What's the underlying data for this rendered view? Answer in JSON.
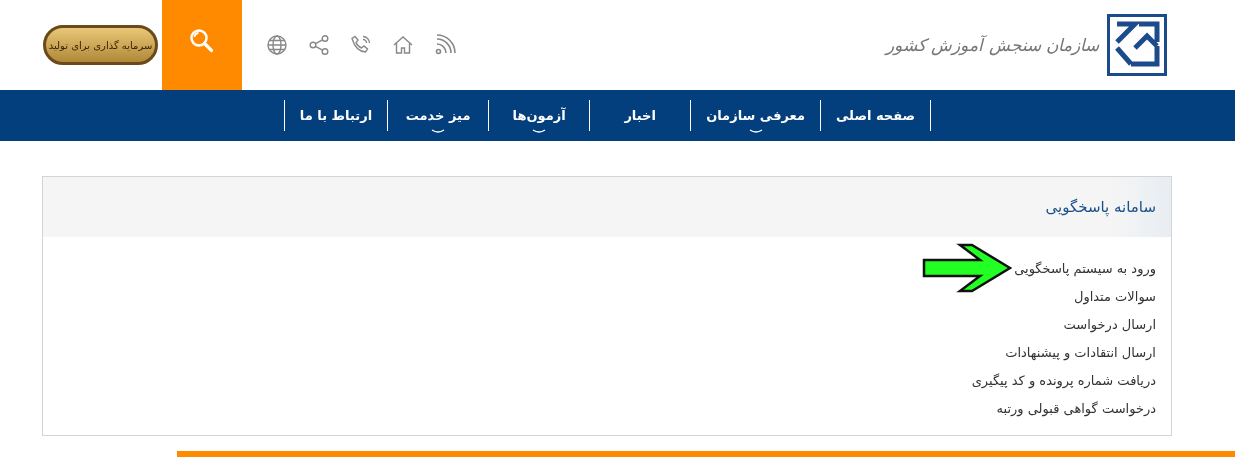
{
  "header": {
    "logo_text": "سازمان سنجش آموزش کشور",
    "badge_text": "سرمایه گذاری برای تولید"
  },
  "nav": [
    {
      "label": "صفحه اصلی",
      "has_dropdown": false
    },
    {
      "label": "معرفی سازمان",
      "has_dropdown": true
    },
    {
      "label": "اخبار",
      "has_dropdown": false
    },
    {
      "label": "آزمون‌ها",
      "has_dropdown": true
    },
    {
      "label": "میز خدمت",
      "has_dropdown": true
    },
    {
      "label": "ارتباط با ما",
      "has_dropdown": false
    }
  ],
  "panel": {
    "title": "سامانه پاسخگویی",
    "links": [
      {
        "label": "ورود به سیستم پاسخگویی",
        "highlighted": true
      },
      {
        "label": "سوالات متداول",
        "highlighted": false
      },
      {
        "label": "ارسال درخواست",
        "highlighted": false
      },
      {
        "label": "ارسال انتقادات و پیشنهادات",
        "highlighted": false
      },
      {
        "label": "دریافت شماره پرونده و کد پیگیری",
        "highlighted": false
      },
      {
        "label": "درخواست گواهی قبولی ورتبه",
        "highlighted": false
      }
    ]
  }
}
